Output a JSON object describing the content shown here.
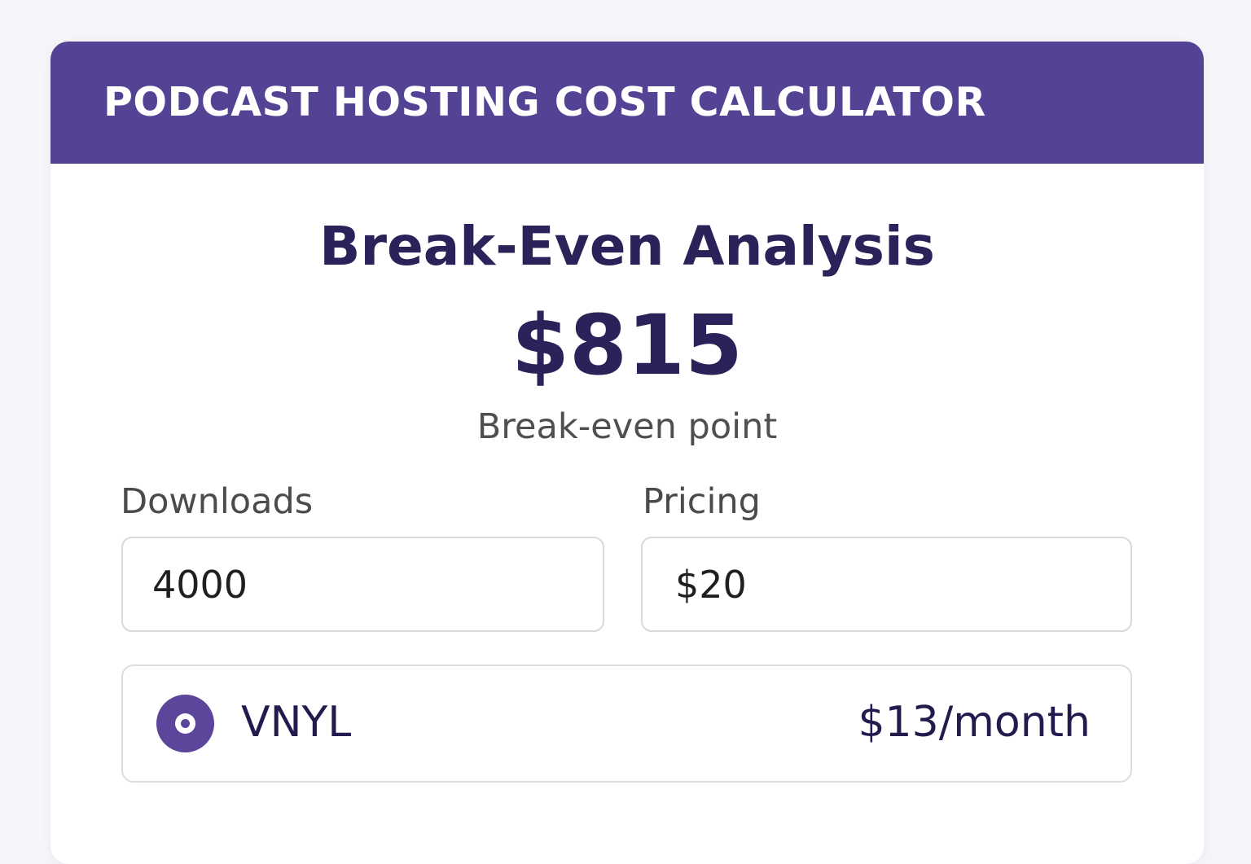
{
  "header": {
    "title": "PODCAST HOSTING COST CALCULATOR"
  },
  "analysis": {
    "title": "Break-Even Analysis",
    "value": "$815",
    "caption": "Break-even point"
  },
  "fields": {
    "downloads": {
      "label": "Downloads",
      "value": "4000"
    },
    "pricing": {
      "label": "Pricing",
      "value": "$20"
    }
  },
  "plan": {
    "name": "VNYL",
    "price": "$13/month",
    "selected": true,
    "icon": "radio-selected-icon"
  },
  "colors": {
    "accent": "#544394",
    "heading": "#2a2258",
    "background": "#f6f6fa"
  }
}
